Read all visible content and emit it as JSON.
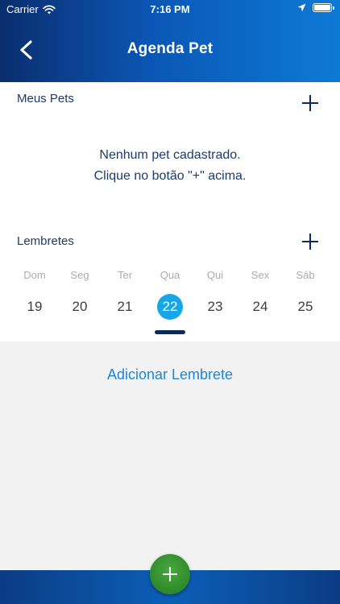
{
  "status_bar": {
    "carrier": "Carrier",
    "time": "7:16 PM"
  },
  "nav": {
    "title": "Agenda Pet",
    "back_icon": "chevron-left-icon"
  },
  "pets": {
    "title": "Meus Pets",
    "empty_line1": "Nenhum pet cadastrado.",
    "empty_line2": "Clique no botão \"+\" acima."
  },
  "reminders": {
    "title": "Lembretes",
    "weekdays": [
      "Dom",
      "Seg",
      "Ter",
      "Qua",
      "Qui",
      "Sex",
      "Sáb"
    ],
    "days": [
      "19",
      "20",
      "21",
      "22",
      "23",
      "24",
      "25"
    ],
    "selected_day": "22",
    "add_label": "Adicionar Lembrete"
  },
  "colors": {
    "header_dark": "#0a2e6e",
    "header_light": "#0d7ad6",
    "selected_day": "#17a6e8",
    "link": "#1f86d6",
    "fab": "#2e8a2a"
  }
}
